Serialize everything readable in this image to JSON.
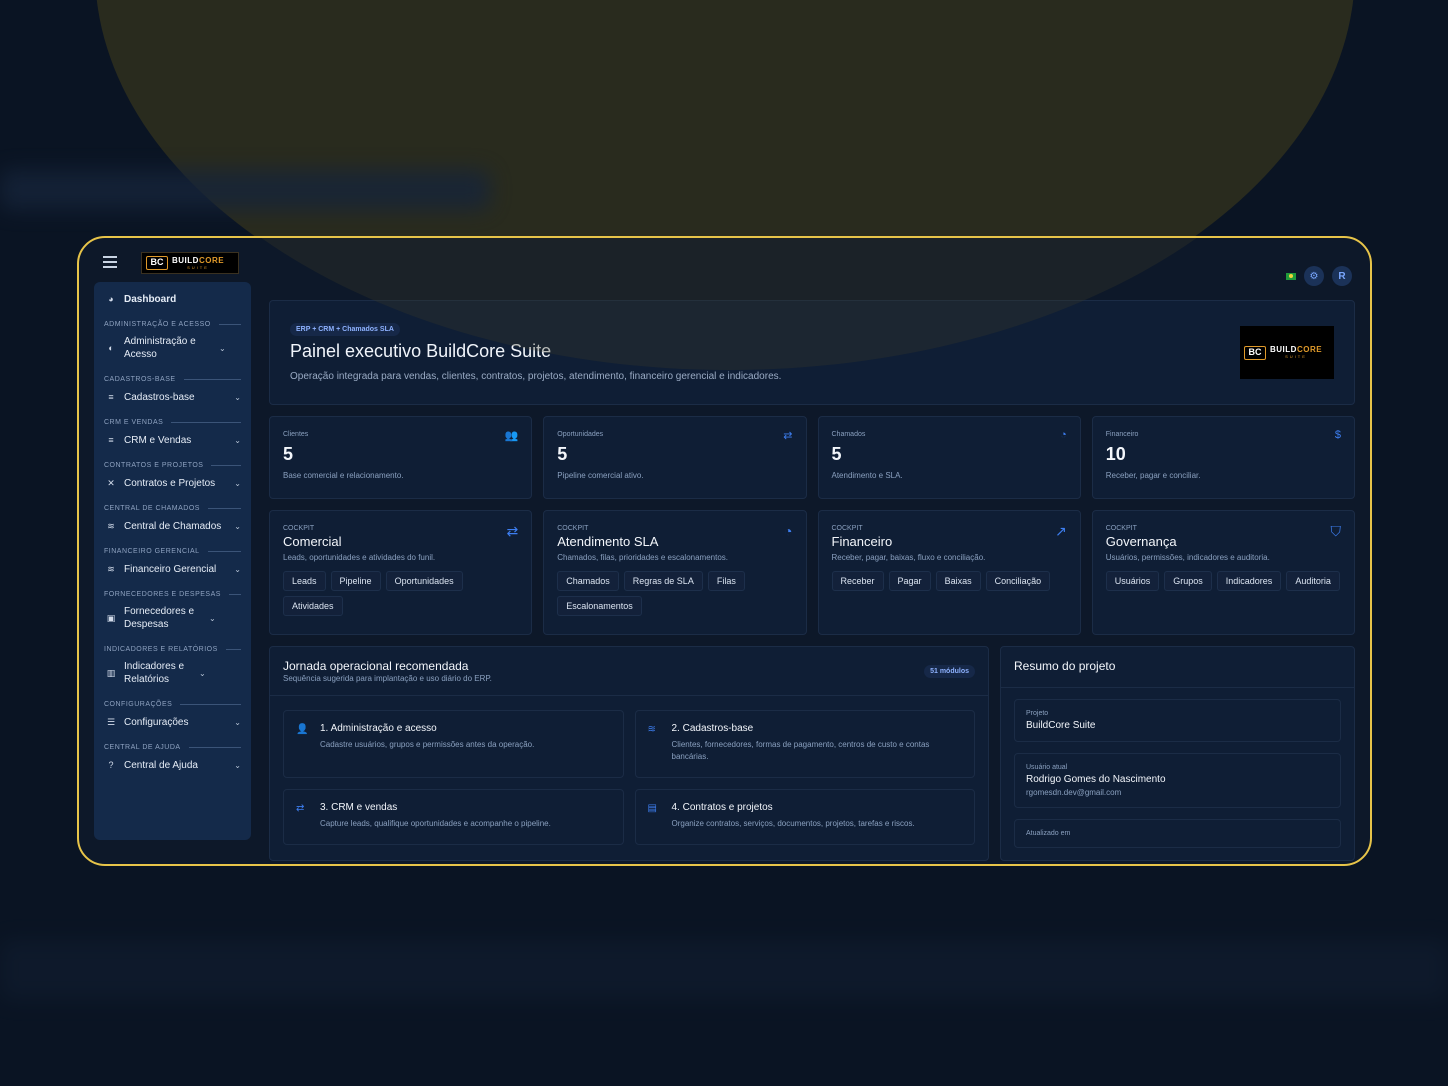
{
  "topbar": {
    "logo_text_a": "BUILD",
    "logo_text_b": "CORE",
    "logo_sub": "SUITE",
    "logo_mark": "BC",
    "avatar_letter": "R"
  },
  "sidebar": {
    "dashboard": "Dashboard",
    "sections": [
      {
        "title": "ADMINISTRAÇÃO E ACESSO",
        "item": "Administração e Acesso"
      },
      {
        "title": "CADASTROS-BASE",
        "item": "Cadastros-base"
      },
      {
        "title": "CRM E VENDAS",
        "item": "CRM e Vendas"
      },
      {
        "title": "CONTRATOS E PROJETOS",
        "item": "Contratos e Projetos"
      },
      {
        "title": "CENTRAL DE CHAMADOS",
        "item": "Central de Chamados"
      },
      {
        "title": "FINANCEIRO GERENCIAL",
        "item": "Financeiro Gerencial"
      },
      {
        "title": "FORNECEDORES E DESPESAS",
        "item": "Fornecedores e Despesas"
      },
      {
        "title": "INDICADORES E RELATÓRIOS",
        "item": "Indicadores e Relatórios"
      },
      {
        "title": "CONFIGURAÇÕES",
        "item": "Configurações"
      },
      {
        "title": "CENTRAL DE AJUDA",
        "item": "Central de Ajuda"
      }
    ]
  },
  "hero": {
    "badge": "ERP + CRM + Chamados SLA",
    "title": "Painel executivo BuildCore Suite",
    "subtitle": "Operação integrada para vendas, clientes, contratos, projetos, atendimento, financeiro gerencial e indicadores."
  },
  "stats": [
    {
      "label": "Clientes",
      "value": "5",
      "desc": "Base comercial e relacionamento.",
      "icon": "users-icon"
    },
    {
      "label": "Oportunidades",
      "value": "5",
      "desc": "Pipeline comercial ativo.",
      "icon": "handshake-icon"
    },
    {
      "label": "Chamados",
      "value": "5",
      "desc": "Atendimento e SLA.",
      "icon": "headset-icon"
    },
    {
      "label": "Financeiro",
      "value": "10",
      "desc": "Receber, pagar e conciliar.",
      "icon": "dollar-icon"
    }
  ],
  "cockpits": [
    {
      "kicker": "COCKPIT",
      "title": "Comercial",
      "desc": "Leads, oportunidades e atividades do funil.",
      "chips": [
        "Leads",
        "Pipeline",
        "Oportunidades",
        "Atividades"
      ]
    },
    {
      "kicker": "COCKPIT",
      "title": "Atendimento SLA",
      "desc": "Chamados, filas, prioridades e escalonamentos.",
      "chips": [
        "Chamados",
        "Regras de SLA",
        "Filas",
        "Escalonamentos"
      ]
    },
    {
      "kicker": "COCKPIT",
      "title": "Financeiro",
      "desc": "Receber, pagar, baixas, fluxo e conciliação.",
      "chips": [
        "Receber",
        "Pagar",
        "Baixas",
        "Conciliação"
      ]
    },
    {
      "kicker": "COCKPIT",
      "title": "Governança",
      "desc": "Usuários, permissões, indicadores e auditoria.",
      "chips": [
        "Usuários",
        "Grupos",
        "Indicadores",
        "Auditoria"
      ]
    }
  ],
  "journey": {
    "title": "Jornada operacional recomendada",
    "subtitle": "Sequência sugerida para implantação e uso diário do ERP.",
    "badge": "51 módulos",
    "steps": [
      {
        "title": "1. Administração e acesso",
        "desc": "Cadastre usuários, grupos e permissões antes da operação."
      },
      {
        "title": "2. Cadastros-base",
        "desc": "Clientes, fornecedores, formas de pagamento, centros de custo e contas bancárias."
      },
      {
        "title": "3. CRM e vendas",
        "desc": "Capture leads, qualifique oportunidades e acompanhe o pipeline."
      },
      {
        "title": "4. Contratos e projetos",
        "desc": "Organize contratos, serviços, documentos, projetos, tarefas e riscos."
      }
    ]
  },
  "summary": {
    "title": "Resumo do projeto",
    "project_label": "Projeto",
    "project_value": "BuildCore Suite",
    "user_label": "Usuário atual",
    "user_name": "Rodrigo Gomes do Nascimento",
    "user_email": "rgomesdn.dev@gmail.com",
    "updated_label": "Atualizado em"
  },
  "colors": {
    "accent": "#3d7ef0",
    "frame_border": "#e7c449",
    "background": "#0d1829"
  }
}
